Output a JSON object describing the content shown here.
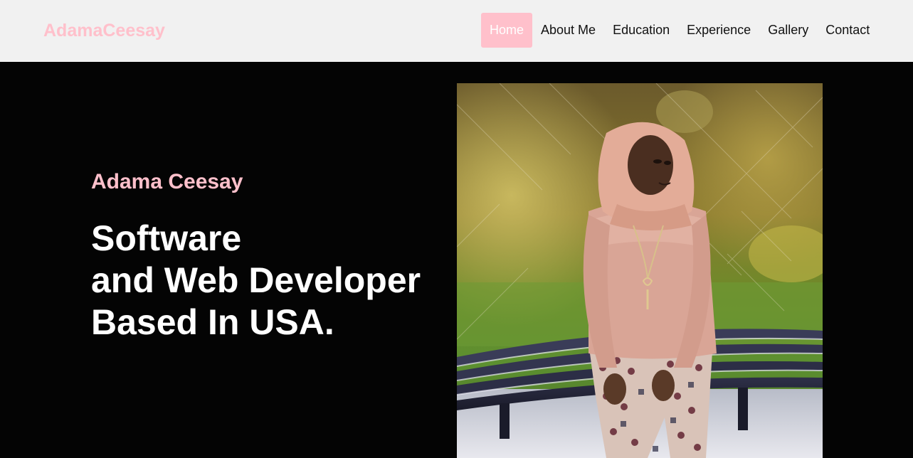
{
  "nav": {
    "brand": "AdamaCeesay",
    "links": [
      {
        "label": "Home",
        "active": true
      },
      {
        "label": "About Me",
        "active": false
      },
      {
        "label": "Education",
        "active": false
      },
      {
        "label": "Experience",
        "active": false
      },
      {
        "label": "Gallery",
        "active": false
      },
      {
        "label": "Contact",
        "active": false
      }
    ]
  },
  "hero": {
    "name": "Adama Ceesay",
    "headline_lines": [
      "Software",
      "and Web Developer",
      "Based In USA."
    ]
  },
  "colors": {
    "accent": "#ffc0cb",
    "nav_bg": "#f1f1f1",
    "hero_bg": "#040404",
    "nav_text": "#111111",
    "hero_text": "#ffffff"
  }
}
